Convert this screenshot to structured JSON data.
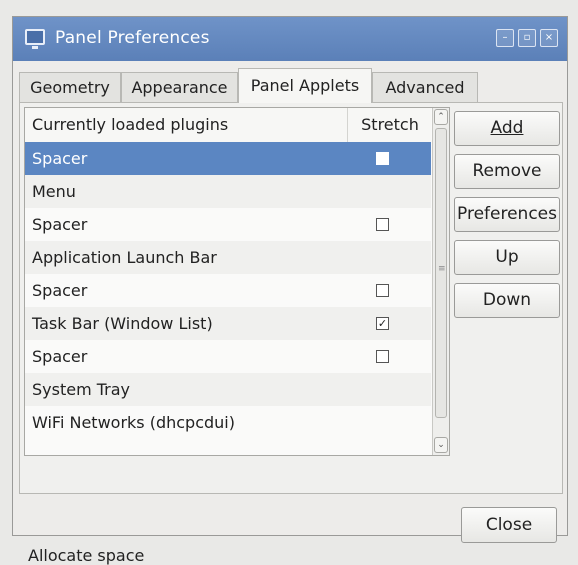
{
  "window": {
    "title": "Panel Preferences",
    "controls": {
      "minimize": "–",
      "maximize": "▫",
      "close": "×"
    }
  },
  "tabs": [
    {
      "label": "Geometry",
      "active": false
    },
    {
      "label": "Appearance",
      "active": false
    },
    {
      "label": "Panel Applets",
      "active": true
    },
    {
      "label": "Advanced",
      "active": false
    }
  ],
  "plugins": {
    "headers": {
      "name": "Currently loaded plugins",
      "stretch": "Stretch"
    },
    "rows": [
      {
        "name": "Spacer",
        "has_stretch": true,
        "stretch": false,
        "selected": true
      },
      {
        "name": "Menu",
        "has_stretch": false,
        "stretch": false,
        "selected": false
      },
      {
        "name": "Spacer",
        "has_stretch": true,
        "stretch": false,
        "selected": false
      },
      {
        "name": "Application Launch Bar",
        "has_stretch": false,
        "stretch": false,
        "selected": false
      },
      {
        "name": "Spacer",
        "has_stretch": true,
        "stretch": false,
        "selected": false
      },
      {
        "name": "Task Bar (Window List)",
        "has_stretch": true,
        "stretch": true,
        "selected": false
      },
      {
        "name": "Spacer",
        "has_stretch": true,
        "stretch": false,
        "selected": false
      },
      {
        "name": "System Tray",
        "has_stretch": false,
        "stretch": false,
        "selected": false
      },
      {
        "name": "WiFi Networks (dhcpcdui)",
        "has_stretch": false,
        "stretch": false,
        "selected": false
      }
    ]
  },
  "scrollbar": {
    "up_arrow": "⌃",
    "down_arrow": "⌄",
    "grip": "≡"
  },
  "actions": {
    "add": "Add",
    "remove": "Remove",
    "preferences": "Preferences",
    "up": "Up",
    "down": "Down"
  },
  "status_text": "Allocate space",
  "footer": {
    "close": "Close"
  },
  "colors": {
    "titlebar": "#5b80b8",
    "selection": "#5b86c2"
  }
}
